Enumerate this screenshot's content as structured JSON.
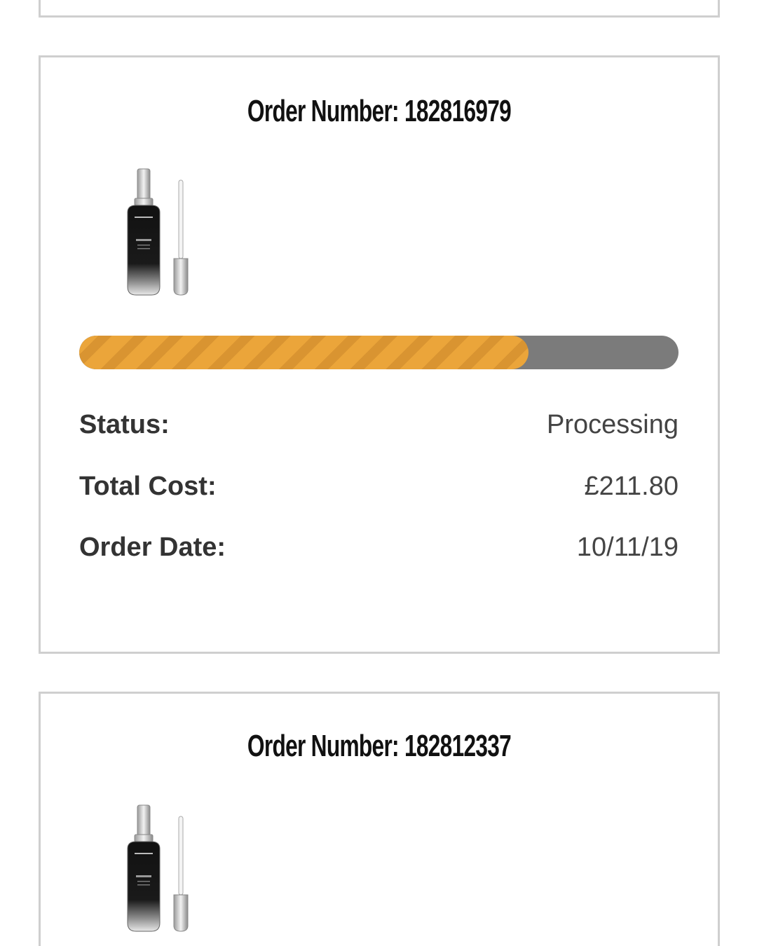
{
  "orders": [
    {
      "title": "Order Number: 182816979",
      "progress": 0.75,
      "status_label": "Status:",
      "status_value": "Processing",
      "cost_label": "Total Cost:",
      "cost_value": "£211.80",
      "date_label": "Order Date:",
      "date_value": "10/11/19",
      "product_icon": "serum-bottle-image"
    },
    {
      "title": "Order Number: 182812337",
      "product_icon": "serum-bottle-image"
    }
  ],
  "colors": {
    "progress_fill": "#eba53a",
    "progress_track": "#7b7b7b",
    "card_border": "#cfcfcf"
  }
}
